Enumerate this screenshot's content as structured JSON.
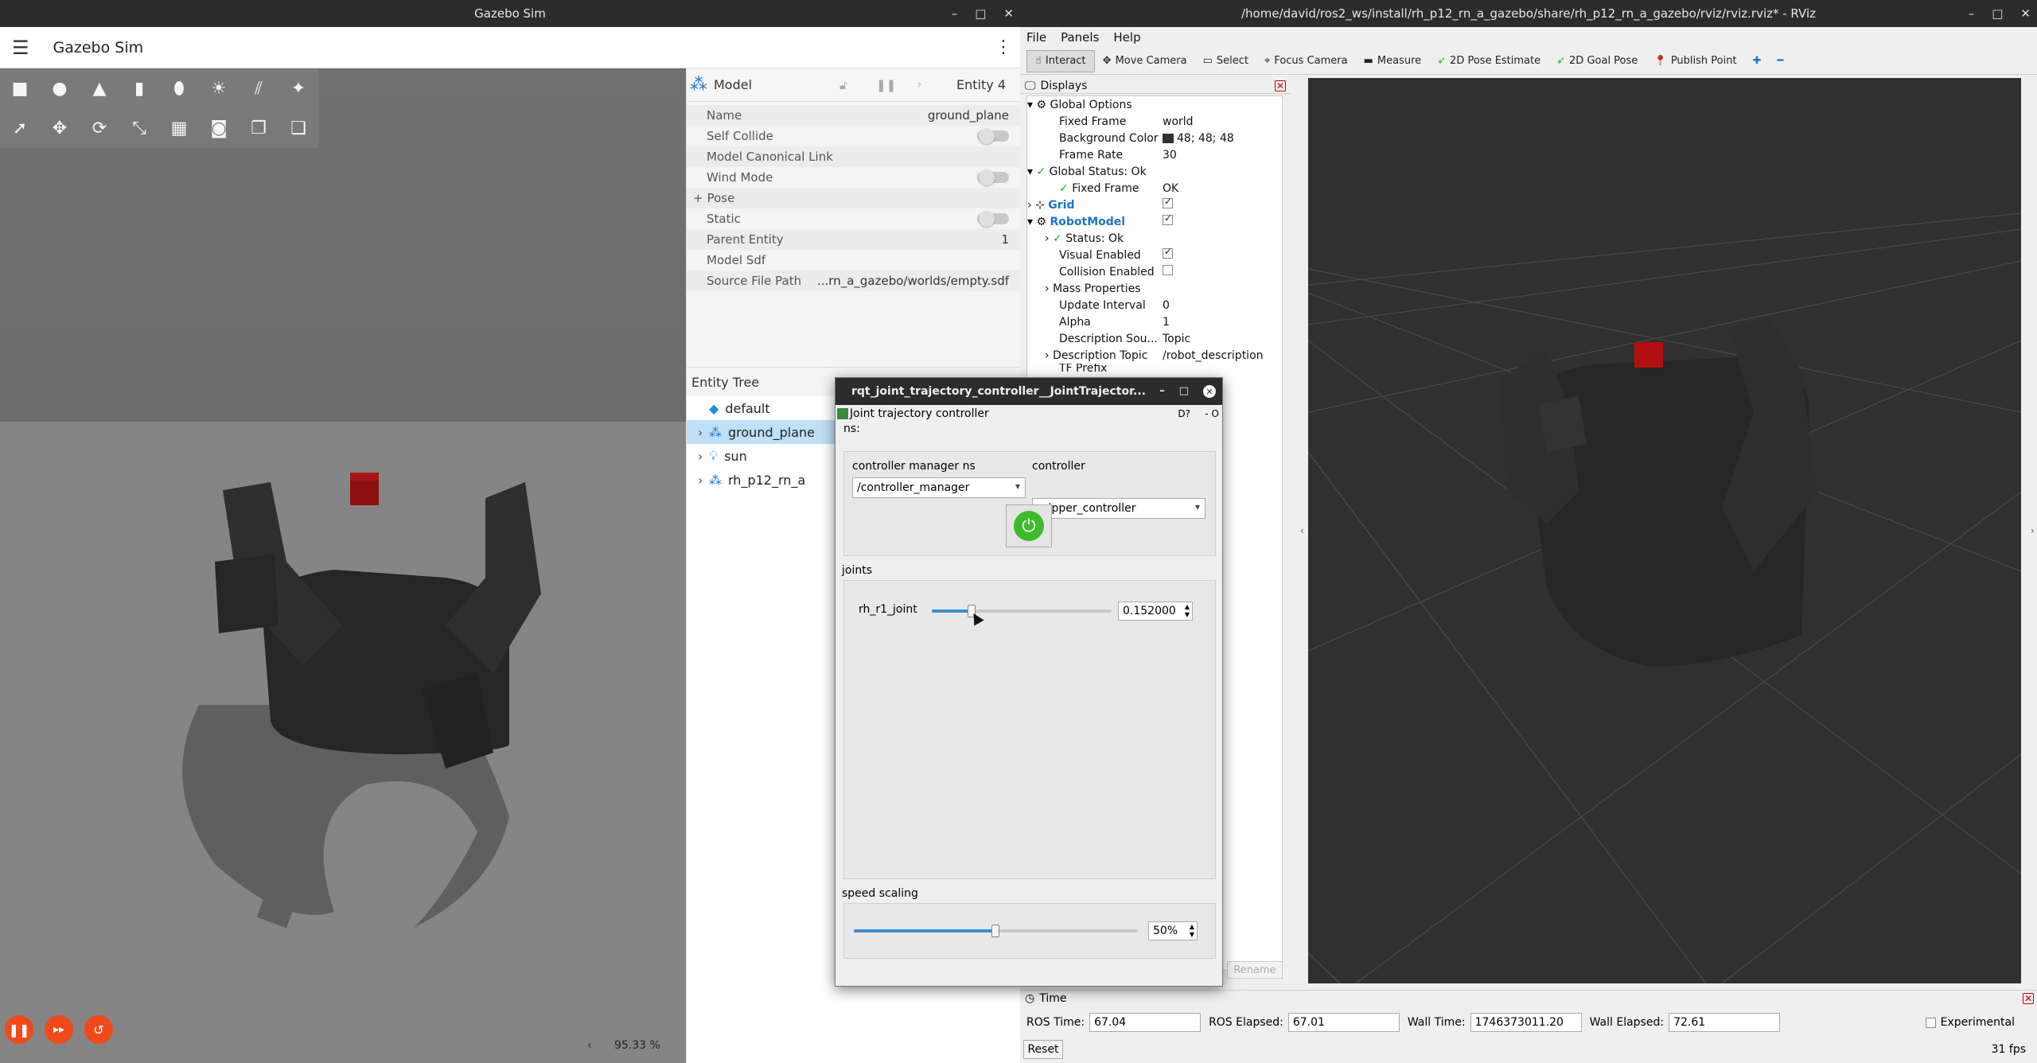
{
  "gazebo": {
    "window_title": "Gazebo Sim",
    "app_title": "Gazebo Sim",
    "zoom_text": "95.33 %",
    "model_panel": {
      "title": "Model",
      "entity": "Entity 4",
      "props": [
        {
          "k": "Name",
          "v": "ground_plane"
        },
        {
          "k": "Self Collide",
          "v": ""
        },
        {
          "k": "Model Canonical Link",
          "v": ""
        },
        {
          "k": "Wind Mode",
          "v": ""
        },
        {
          "k": "Pose",
          "v": ""
        },
        {
          "k": "Static",
          "v": ""
        },
        {
          "k": "Parent Entity",
          "v": "1"
        },
        {
          "k": "Model Sdf",
          "v": ""
        },
        {
          "k": "Source File Path",
          "v": "...rn_a_gazebo/worlds/empty.sdf"
        }
      ],
      "pose_expander": "+"
    },
    "entity_tree": {
      "title": "Entity Tree",
      "items": [
        "default",
        "ground_plane",
        "sun",
        "rh_p12_rn_a"
      ]
    }
  },
  "rqt": {
    "window_title": "rqt_joint_trajectory_controller__JointTrajector...",
    "plugin_title": "Joint trajectory controller",
    "plugin_badges": "D?",
    "plugin_ctrl": "- O",
    "ns_label": "ns:",
    "cm_label": "controller manager ns",
    "cm_value": "/controller_manager",
    "controller_label": "controller",
    "controller_value": "gripper_controller",
    "joints_label": "joints",
    "joint_name": "rh_r1_joint",
    "joint_value": "0.152000",
    "joint_slider_fraction": 0.22,
    "speed_label": "speed scaling",
    "speed_value": "50%",
    "speed_fraction": 0.5
  },
  "rviz": {
    "window_title": "/home/david/ros2_ws/install/rh_p12_rn_a_gazebo/share/rh_p12_rn_a_gazebo/rviz/rviz.rviz* - RViz",
    "menu": [
      "File",
      "Panels",
      "Help"
    ],
    "tools": [
      "Interact",
      "Move Camera",
      "Select",
      "Focus Camera",
      "Measure",
      "2D Pose Estimate",
      "2D Goal Pose",
      "Publish Point"
    ],
    "displays_title": "Displays",
    "displays": {
      "global_options": "Global Options",
      "fixed_frame_k": "Fixed Frame",
      "fixed_frame_v": "world",
      "bg_k": "Background Color",
      "bg_v": "48; 48; 48",
      "frame_rate_k": "Frame Rate",
      "frame_rate_v": "30",
      "global_status": "Global Status: Ok",
      "gs_fixed_frame_k": "Fixed Frame",
      "gs_fixed_frame_v": "OK",
      "grid": "Grid",
      "robot_model": "RobotModel",
      "status_ok": "Status: Ok",
      "visual_enabled": "Visual Enabled",
      "collision_enabled": "Collision Enabled",
      "mass_props": "Mass Properties",
      "update_interval_k": "Update Interval",
      "update_interval_v": "0",
      "alpha_k": "Alpha",
      "alpha_v": "1",
      "desc_source_k": "Description Sou...",
      "desc_source_v": "Topic",
      "desc_topic_k": "Description Topic",
      "desc_topic_v": "/robot_description",
      "tf_prefix": "TF Prefix"
    },
    "rename_button": "Rename",
    "time_panel": {
      "title": "Time",
      "ros_time_label": "ROS Time:",
      "ros_time": "67.04",
      "ros_elapsed_label": "ROS Elapsed:",
      "ros_elapsed": "67.01",
      "wall_time_label": "Wall Time:",
      "wall_time": "1746373011.20",
      "wall_elapsed_label": "Wall Elapsed:",
      "wall_elapsed": "72.61",
      "experimental": "Experimental",
      "reset": "Reset",
      "fps": "31 fps"
    }
  },
  "colors": {
    "accent_blue": "#1e73c8",
    "play_orange": "#f04a1c",
    "power_green": "#3dbb2d",
    "selection": "#bfe0f6"
  }
}
